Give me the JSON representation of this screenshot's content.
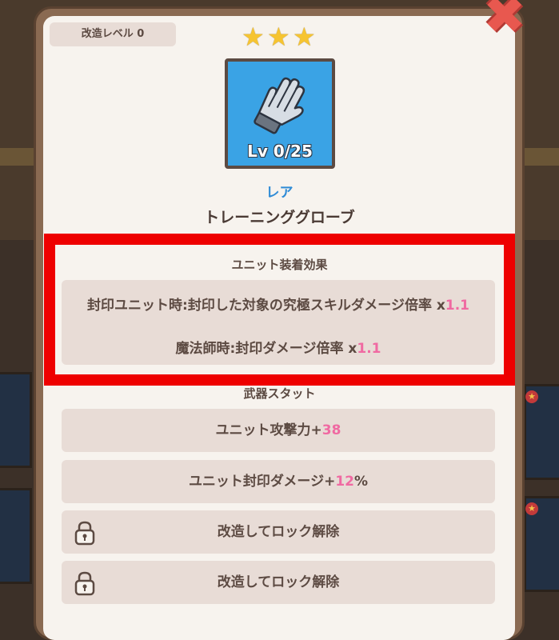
{
  "modify_level_label": "改造レベル 0",
  "stars": [
    "★",
    "★",
    "★"
  ],
  "item": {
    "level_text": "Lv 0/25",
    "rarity": "レア",
    "name": "トレーニンググローブ"
  },
  "equip_effects": {
    "title": "ユニット装着効果",
    "lines": [
      {
        "text": "封印ユニット時:封印した対象の究極スキルダメージ倍率  x",
        "value": "1.1"
      },
      {
        "text": "魔法師時:封印ダメージ倍率  x",
        "value": "1.1"
      }
    ]
  },
  "weapon_stats": {
    "title": "武器スタット",
    "rows": [
      {
        "prefix": "ユニット攻撃力+",
        "value": "38",
        "suffix": ""
      },
      {
        "prefix": "ユニット封印ダメージ+",
        "value": "12",
        "suffix": "%"
      }
    ],
    "locked_rows": [
      "改造してロック解除",
      "改造してロック解除"
    ]
  },
  "close_label": "✖",
  "colors": {
    "accent_pink": "#f06aa2",
    "rarity_blue": "#2f8bd6",
    "highlight_red": "#ee0000",
    "item_bg": "#3aa3e5"
  }
}
